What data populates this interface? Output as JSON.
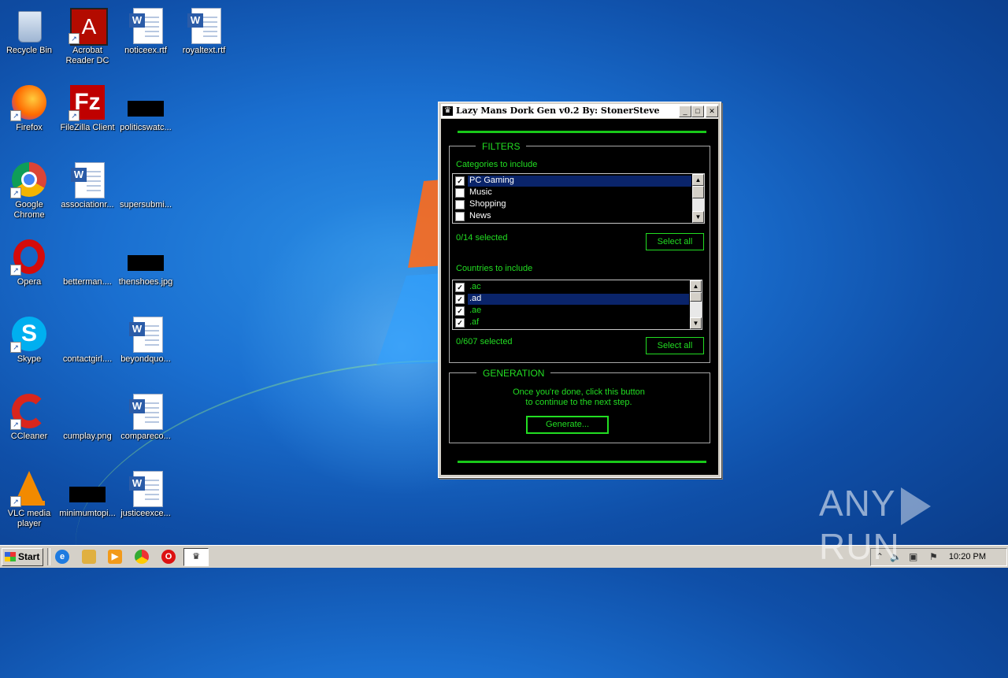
{
  "desktop": {
    "icons": [
      {
        "label": "Recycle Bin",
        "icon": "recycle-bin-icon"
      },
      {
        "label": "Acrobat\nReader DC",
        "icon": "acrobat-icon"
      },
      {
        "label": "noticeex.rtf",
        "icon": "word-doc-icon"
      },
      {
        "label": "royaltext.rtf",
        "icon": "word-doc-icon"
      },
      {
        "label": "Firefox",
        "icon": "firefox-icon"
      },
      {
        "label": "FileZilla Client",
        "icon": "filezilla-icon"
      },
      {
        "label": "politicswatc...",
        "icon": "black-image-icon"
      },
      {
        "label": "Google\nChrome",
        "icon": "chrome-icon"
      },
      {
        "label": "associationr...",
        "icon": "word-doc-icon"
      },
      {
        "label": "supersubmi...",
        "icon": "blank-file-icon"
      },
      {
        "label": "Opera",
        "icon": "opera-icon"
      },
      {
        "label": "betterman....",
        "icon": "blank-file-icon"
      },
      {
        "label": "thenshoes.jpg",
        "icon": "black-image-icon"
      },
      {
        "label": "Skype",
        "icon": "skype-icon"
      },
      {
        "label": "contactgirl....",
        "icon": "blank-file-icon"
      },
      {
        "label": "beyondquo...",
        "icon": "word-doc-icon"
      },
      {
        "label": "CCleaner",
        "icon": "ccleaner-icon"
      },
      {
        "label": "cumplay.png",
        "icon": "blank-file-icon"
      },
      {
        "label": "compareco...",
        "icon": "word-doc-icon"
      },
      {
        "label": "VLC media\nplayer",
        "icon": "vlc-icon"
      },
      {
        "label": "minimumtopi...",
        "icon": "black-image-icon"
      },
      {
        "label": "justiceexce...",
        "icon": "word-doc-icon"
      }
    ]
  },
  "window": {
    "title": "Lazy Mans Dork Gen v0.2 By: StonerSteve",
    "controls": {
      "minimize": "_",
      "maximize": "□",
      "close": "✕"
    },
    "filters": {
      "heading": "FILTERS",
      "categories_label": "Categories to include",
      "categories": [
        {
          "label": "PC Gaming",
          "checked": true,
          "selected": true
        },
        {
          "label": "Music",
          "checked": false,
          "selected": false
        },
        {
          "label": "Shopping",
          "checked": false,
          "selected": false
        },
        {
          "label": "News",
          "checked": false,
          "selected": false
        }
      ],
      "categories_count": "0/14 selected",
      "categories_select_all": "Select all",
      "countries_label": "Countries to include",
      "countries": [
        {
          "label": ".ac",
          "checked": true,
          "selected": false
        },
        {
          "label": ".ad",
          "checked": true,
          "selected": true
        },
        {
          "label": ".ae",
          "checked": true,
          "selected": false
        },
        {
          "label": ".af",
          "checked": true,
          "selected": false
        }
      ],
      "countries_count": "0/607 selected",
      "countries_select_all": "Select all"
    },
    "generation": {
      "heading": "GENERATION",
      "hint_line1": "Once you're done, click this button",
      "hint_line2": "to continue to the next step.",
      "generate_button": "Generate..."
    }
  },
  "taskbar": {
    "start_label": "Start",
    "quick_launch": [
      "ie-icon",
      "explorer-icon",
      "media-player-icon",
      "chrome-icon",
      "opera-icon"
    ],
    "active_task_icon": "♛",
    "tray": {
      "clock": "10:20 PM"
    }
  },
  "watermark": {
    "left": "ANY",
    "right": "RUN"
  }
}
